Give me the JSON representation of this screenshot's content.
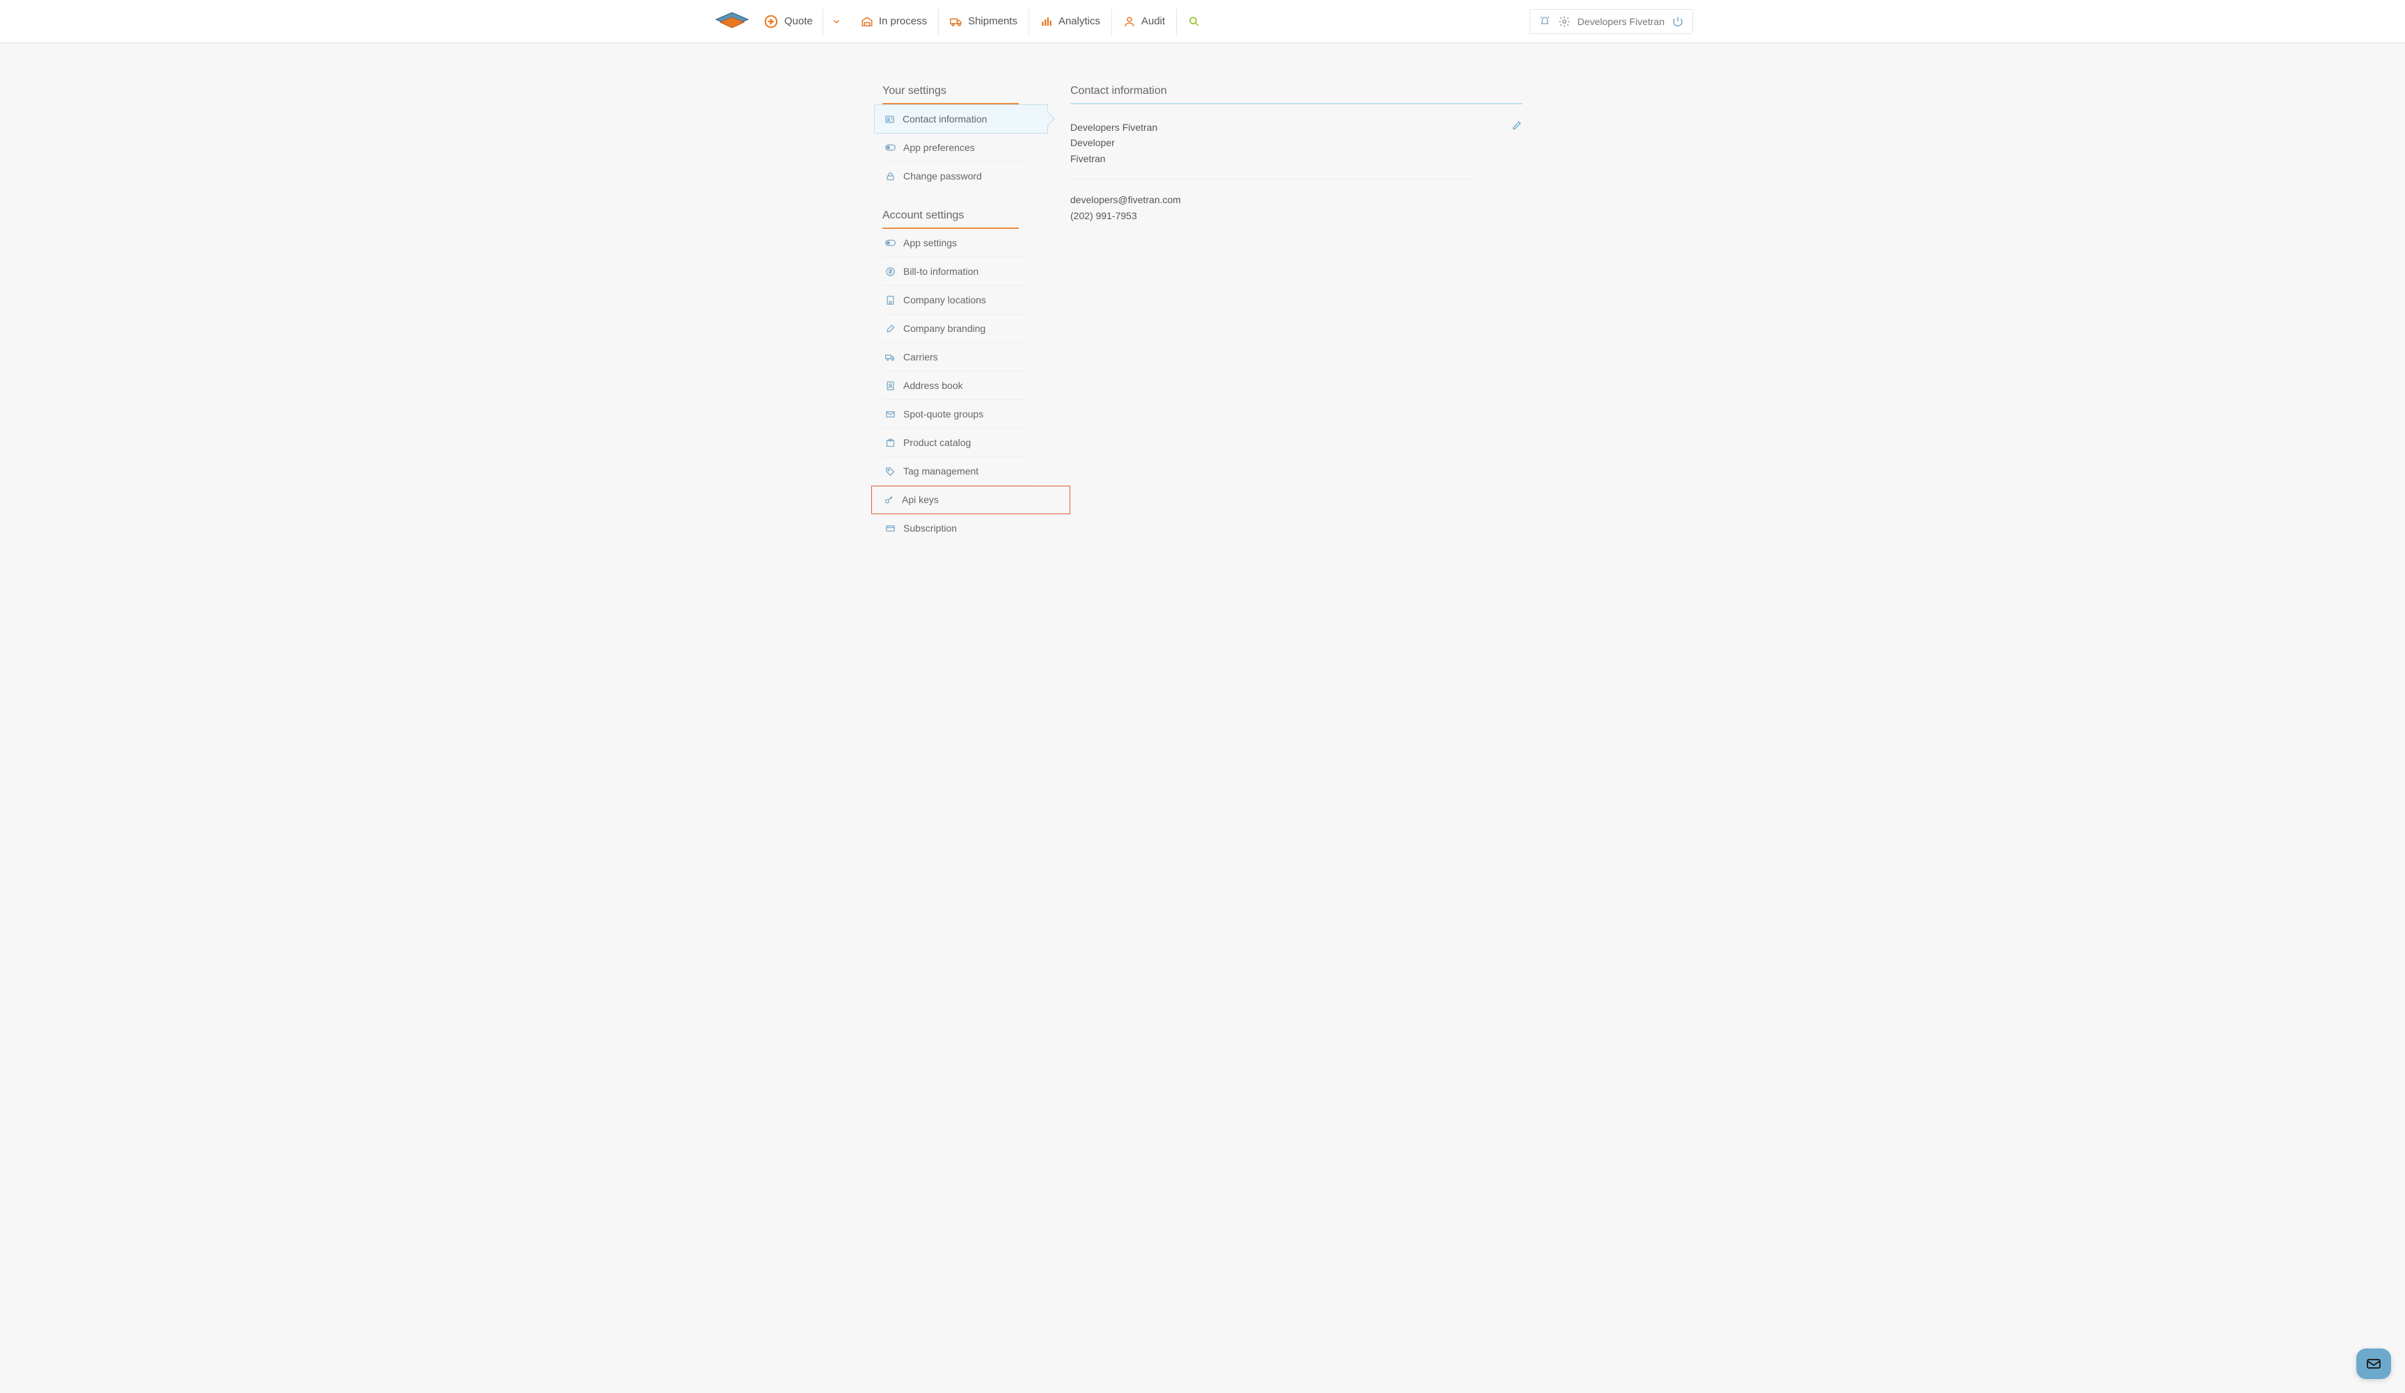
{
  "nav": {
    "quote": "Quote",
    "in_process": "In process",
    "shipments": "Shipments",
    "analytics": "Analytics",
    "audit": "Audit"
  },
  "user": {
    "name": "Developers Fivetran"
  },
  "sidebar": {
    "your_settings": "Your settings",
    "account_settings": "Account settings",
    "your_items": [
      "Contact information",
      "App preferences",
      "Change password"
    ],
    "account_items": [
      "App settings",
      "Bill-to information",
      "Company locations",
      "Company branding",
      "Carriers",
      "Address book",
      "Spot-quote groups",
      "Product catalog",
      "Tag management",
      "Api keys",
      "Subscription"
    ]
  },
  "main": {
    "title": "Contact information",
    "name": "Developers Fivetran",
    "role": "Developer",
    "company": "Fivetran",
    "email": "developers@fivetran.com",
    "phone": "(202) 991-7953"
  }
}
